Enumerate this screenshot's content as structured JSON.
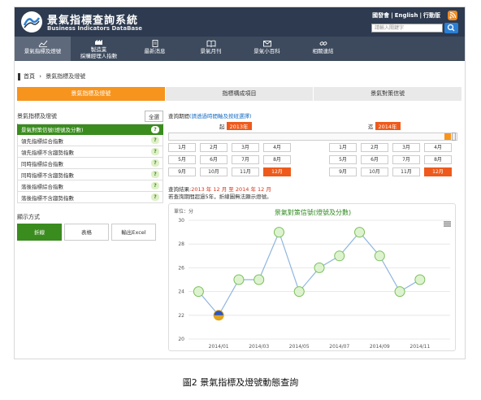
{
  "header": {
    "title": "景氣指標查詢系統",
    "subtitle": "Business Indicators DataBase",
    "links": [
      "國發會",
      "English",
      "行動版"
    ],
    "search_placeholder": "請輸入關鍵字"
  },
  "nav": [
    {
      "label": "景氣指標及燈號",
      "icon": "chart-icon"
    },
    {
      "label": "製造業\n採購經理人指數",
      "icon": "factory-icon"
    },
    {
      "label": "最新消息",
      "icon": "news-icon"
    },
    {
      "label": "景氣月刊",
      "icon": "book-icon"
    },
    {
      "label": "景氣小百科",
      "icon": "mail-icon"
    },
    {
      "label": "相關連結",
      "icon": "link-icon"
    }
  ],
  "breadcrumb": {
    "home": "首頁",
    "sep": "›",
    "current": "景氣指標及燈號"
  },
  "tabs": [
    "景氣指標及燈號",
    "指標構成項目",
    "景氣對策信號"
  ],
  "left": {
    "heading": "景氣指標及燈號",
    "all_label": "全選",
    "indicators": [
      "景氣對策信號(燈號及分數)",
      "領先指標綜合指數",
      "領先指標不含趨勢指數",
      "同時指標綜合指數",
      "同時指標不含趨勢指數",
      "落後指標綜合指數",
      "落後指標不含趨勢指數"
    ],
    "q_mark": "?",
    "display_heading": "顯示方式",
    "display_buttons": [
      "折線",
      "表格",
      "輸出Excel"
    ]
  },
  "query": {
    "label": "查詢期間",
    "hint": "(請透過時間軸及按紐選擇)",
    "from_prefix": "起",
    "from_year": "2013年",
    "to_prefix": "迄",
    "to_year": "2014年",
    "months": [
      "1月",
      "2月",
      "3月",
      "4月",
      "5月",
      "6月",
      "7月",
      "8月",
      "9月",
      "10月",
      "11月",
      "12月"
    ],
    "selected_month": "12月",
    "result_label": "查詢結果:",
    "result_value": "2013 年 12 月 至 2014 年 12 月",
    "note": "若查詢期間超過5年，折線圖無法顯示燈號。"
  },
  "colors": {
    "accent": "#f7941d",
    "green": "#3a8c1e",
    "highlight": "#ee5a1c",
    "header": "#2d3a4f"
  },
  "chart_data": {
    "type": "line",
    "title": "景氣對策信號(燈號及分數)",
    "unit_label": "單位：分",
    "x": [
      "2013/12",
      "2014/01",
      "2014/02",
      "2014/03",
      "2014/04",
      "2014/05",
      "2014/06",
      "2014/07",
      "2014/08",
      "2014/09",
      "2014/10",
      "2014/11",
      "2014/12"
    ],
    "values": [
      24,
      22,
      25,
      25,
      29,
      24,
      26,
      27,
      29,
      27,
      24,
      25
    ],
    "x_tick_labels": [
      "2014/01",
      "2014/03",
      "2014/05",
      "2014/07",
      "2014/09",
      "2014/11"
    ],
    "y_ticks": [
      20,
      22,
      24,
      26,
      28,
      30
    ],
    "ylim": [
      20,
      30
    ],
    "light_colors": [
      "#ddf3d0",
      "#2c56c4",
      "#ddf3d0",
      "#ddf3d0",
      "#ddf3d0",
      "#ddf3d0",
      "#ddf3d0",
      "#ddf3d0",
      "#ddf3d0",
      "#ddf3d0",
      "#ddf3d0",
      "#ddf3d0"
    ]
  },
  "caption": "圖2  景氣指標及燈號動態查詢"
}
